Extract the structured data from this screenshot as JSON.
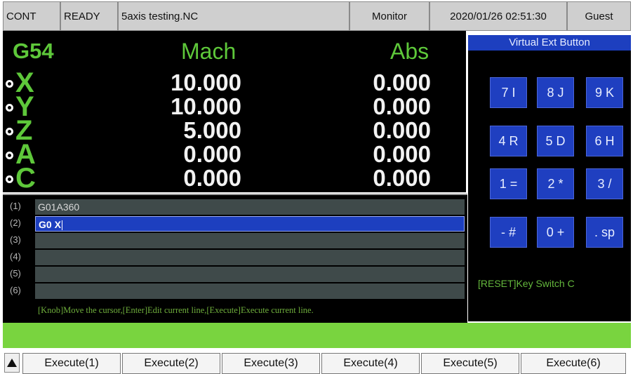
{
  "status": {
    "mode": "CONT",
    "state": "READY",
    "program": "5axis testing.NC",
    "page": "Monitor",
    "datetime": "2020/01/26 02:51:30",
    "user": "Guest"
  },
  "coords": {
    "work_offset": "G54",
    "mach_header": "Mach",
    "abs_header": "Abs",
    "axes": [
      {
        "name": "X",
        "mach": "10.000",
        "abs": "0.000"
      },
      {
        "name": "Y",
        "mach": "10.000",
        "abs": "0.000"
      },
      {
        "name": "Z",
        "mach": "5.000",
        "abs": "0.000"
      },
      {
        "name": "A",
        "mach": "0.000",
        "abs": "0.000"
      },
      {
        "name": "C",
        "mach": "0.000",
        "abs": "0.000"
      }
    ]
  },
  "mdi": {
    "lines": [
      {
        "num": "(1)",
        "text": "G01A360"
      },
      {
        "num": "(2)",
        "text": "G0 X"
      },
      {
        "num": "(3)",
        "text": ""
      },
      {
        "num": "(4)",
        "text": ""
      },
      {
        "num": "(5)",
        "text": ""
      },
      {
        "num": "(6)",
        "text": ""
      }
    ],
    "hint": "[Knob]Move the cursor,[Enter]Edit current line,[Execute]Execute current line."
  },
  "virtual_buttons": {
    "title": "Virtual Ext Button",
    "keys": [
      "7 I",
      "8 J",
      "9 K",
      "4 R",
      "5 D",
      "6 H",
      "1 =",
      "2 *",
      "3 /",
      "- #",
      "0 +",
      ". sp"
    ],
    "status_text": "[RESET]Key Switch C"
  },
  "softkeys": {
    "scroll_icon": "up-triangle-icon",
    "labels": [
      "Execute(1)",
      "Execute(2)",
      "Execute(3)",
      "Execute(4)",
      "Execute(5)",
      "Execute(6)"
    ]
  },
  "colors": {
    "accent_green": "#5ec83a",
    "key_blue": "#1f3fc0",
    "message_bar": "#79d43f"
  }
}
